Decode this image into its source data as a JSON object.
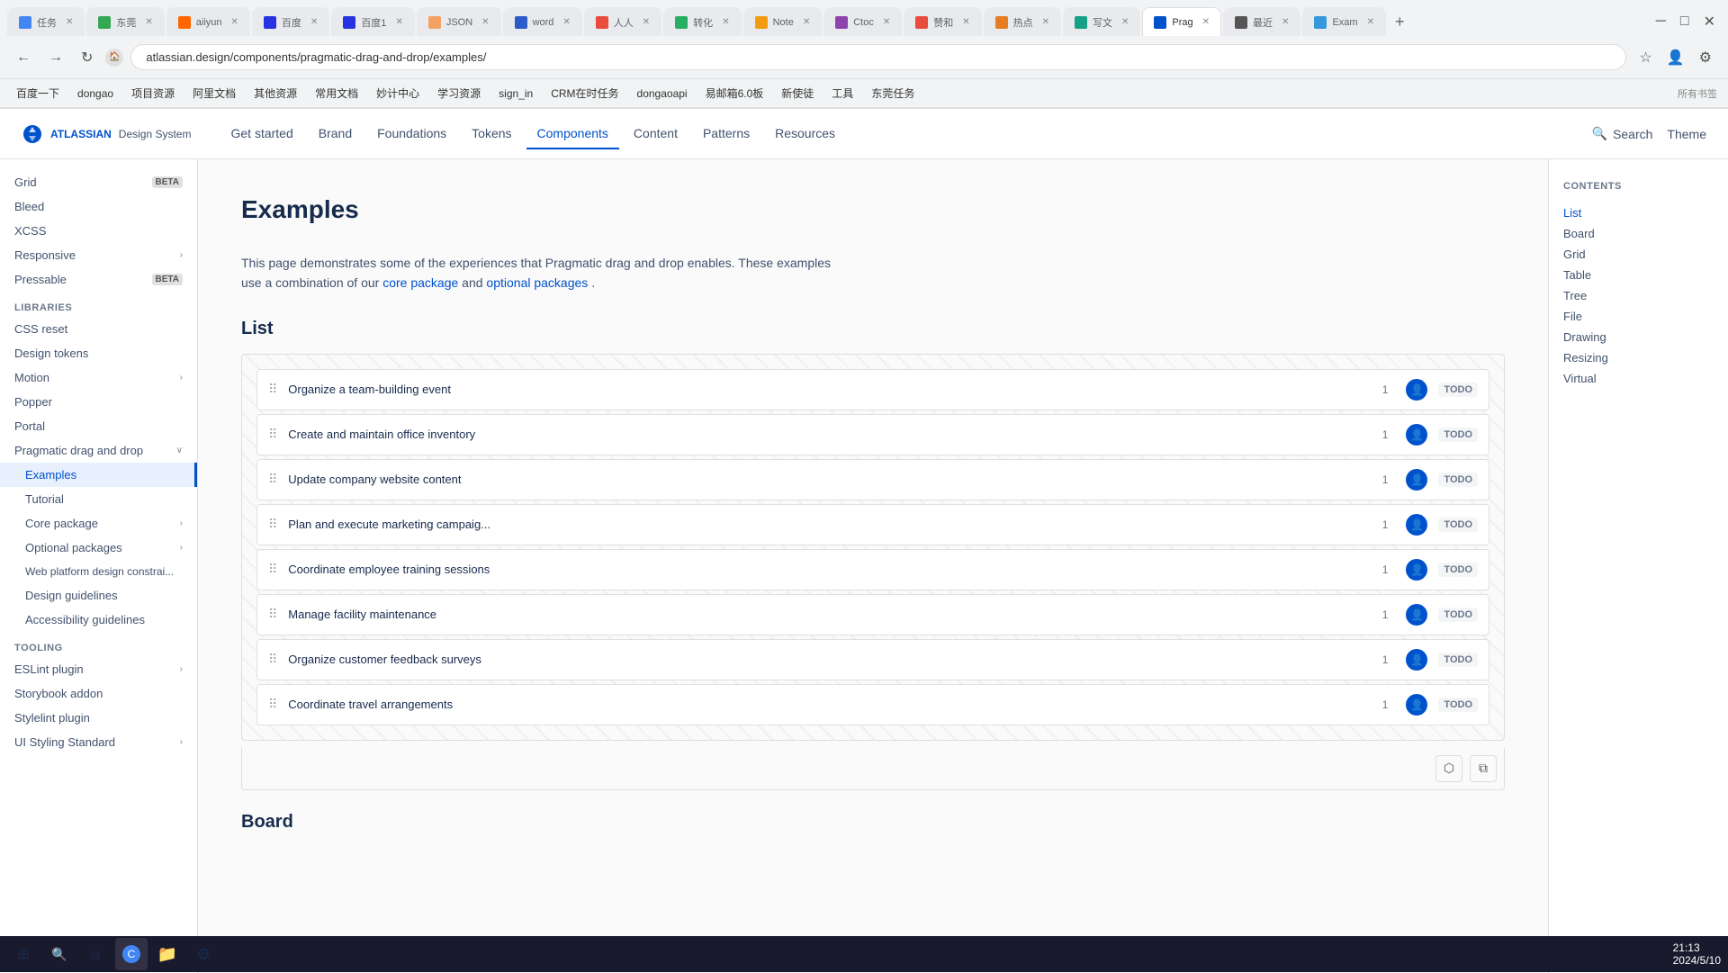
{
  "browser": {
    "url": "atlassian.design/components/pragmatic-drag-and-drop/examples/",
    "tabs": [
      {
        "label": "任务",
        "active": false
      },
      {
        "label": "东莞",
        "active": false
      },
      {
        "label": "aiiyun",
        "active": false
      },
      {
        "label": "百度",
        "active": false
      },
      {
        "label": "百度1",
        "active": false
      },
      {
        "label": "JSON",
        "active": false
      },
      {
        "label": "word",
        "active": false
      },
      {
        "label": "人人",
        "active": false
      },
      {
        "label": "转化",
        "active": false
      },
      {
        "label": "Note",
        "active": false
      },
      {
        "label": "Ctoc",
        "active": false
      },
      {
        "label": "赞和",
        "active": false
      },
      {
        "label": "热点",
        "active": false
      },
      {
        "label": "写文",
        "active": false
      },
      {
        "label": "Prag",
        "active": true
      },
      {
        "label": "最近",
        "active": false
      },
      {
        "label": "Exam",
        "active": false
      }
    ],
    "bookmarks": [
      "百度一下",
      "dongao",
      "项目资源",
      "阿里文档",
      "其他资源",
      "常用文档",
      "妙计中心",
      "学习资源",
      "sign_in",
      "CRM在时任务",
      "dongaoapi",
      "易邮箱6.0板",
      "新使徒",
      "工具",
      "东莞任务"
    ]
  },
  "topnav": {
    "logo": "ATLASSIAN Design System",
    "links": [
      "Get started",
      "Brand",
      "Foundations",
      "Tokens",
      "Components",
      "Content",
      "Patterns",
      "Resources"
    ],
    "active_link": "Components",
    "search_label": "Search",
    "theme_label": "Theme"
  },
  "sidebar": {
    "sections": [
      {
        "items": [
          {
            "label": "Grid",
            "badge": "BETA",
            "expandable": false
          },
          {
            "label": "Bleed",
            "expandable": false
          },
          {
            "label": "XCSS",
            "expandable": false
          },
          {
            "label": "Responsive",
            "expandable": true
          },
          {
            "label": "Pressable",
            "badge": "BETA",
            "expandable": false
          }
        ]
      },
      {
        "section_label": "LIBRARIES",
        "items": [
          {
            "label": "CSS reset",
            "expandable": false
          },
          {
            "label": "Design tokens",
            "expandable": false
          },
          {
            "label": "Motion",
            "expandable": true
          },
          {
            "label": "Popper",
            "expandable": false
          },
          {
            "label": "Portal",
            "expandable": false
          },
          {
            "label": "Pragmatic drag and drop",
            "expandable": true,
            "active": false
          },
          {
            "label": "Examples",
            "active": true,
            "sub": true
          },
          {
            "label": "Tutorial",
            "sub": true
          },
          {
            "label": "Core package",
            "sub": true,
            "expandable": true
          },
          {
            "label": "Optional packages",
            "sub": true,
            "expandable": true
          },
          {
            "label": "Web platform design constrai...",
            "sub": true
          },
          {
            "label": "Design guidelines",
            "sub": true
          },
          {
            "label": "Accessibility guidelines",
            "sub": true
          }
        ]
      },
      {
        "section_label": "TOOLING",
        "items": [
          {
            "label": "ESLint plugin",
            "expandable": true
          },
          {
            "label": "Storybook addon",
            "expandable": false
          },
          {
            "label": "Stylelint plugin",
            "expandable": false
          },
          {
            "label": "UI Styling Standard",
            "expandable": true
          }
        ]
      }
    ]
  },
  "main": {
    "page_title": "Examples",
    "description": "This page demonstrates some of the experiences that Pragmatic drag and drop enables. These examples use a combination of our",
    "description_link1": "core package",
    "description_middle": "and",
    "description_link2": "optional packages",
    "description_end": ".",
    "list_section": {
      "title": "List",
      "items": [
        {
          "text": "Organize a team-building event",
          "count": "1",
          "todo": "TODO"
        },
        {
          "text": "Create and maintain office inventory",
          "count": "1",
          "todo": "TODO"
        },
        {
          "text": "Update company website content",
          "count": "1",
          "todo": "TODO"
        },
        {
          "text": "Plan and execute marketing campaig...",
          "count": "1",
          "todo": "TODO"
        },
        {
          "text": "Coordinate employee training sessions",
          "count": "1",
          "todo": "TODO"
        },
        {
          "text": "Manage facility maintenance",
          "count": "1",
          "todo": "TODO"
        },
        {
          "text": "Organize customer feedback surveys",
          "count": "1",
          "todo": "TODO"
        },
        {
          "text": "Coordinate travel arrangements",
          "count": "1",
          "todo": "TODO"
        }
      ]
    },
    "board_section": {
      "title": "Board"
    }
  },
  "contents": {
    "title": "CONTENTS",
    "items": [
      {
        "label": "List",
        "active": true
      },
      {
        "label": "Board",
        "active": false
      },
      {
        "label": "Grid",
        "active": false
      },
      {
        "label": "Table",
        "active": false
      },
      {
        "label": "Tree",
        "active": false
      },
      {
        "label": "File",
        "active": false
      },
      {
        "label": "Drawing",
        "active": false
      },
      {
        "label": "Resizing",
        "active": false
      },
      {
        "label": "Virtual",
        "active": false
      }
    ]
  },
  "taskbar": {
    "time": "21:13",
    "date": "2024/5/10"
  }
}
